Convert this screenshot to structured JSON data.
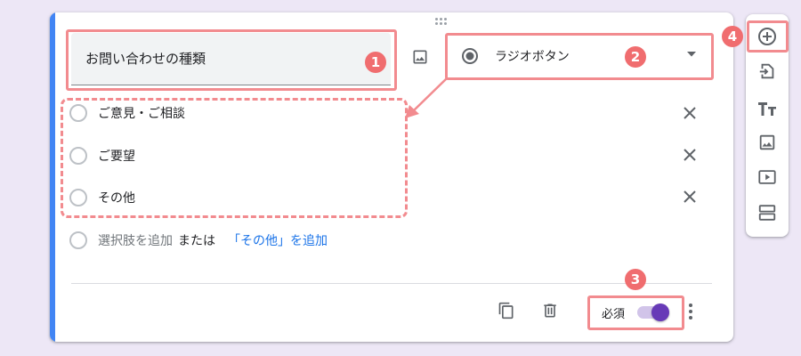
{
  "question": {
    "title": "お問い合わせの種類",
    "type_label": "ラジオボタン",
    "options": [
      {
        "label": "ご意見・ご相談"
      },
      {
        "label": "ご要望"
      },
      {
        "label": "その他"
      }
    ],
    "add_option_label": "選択肢を追加",
    "or_label": "または",
    "add_other_label": "「その他」を追加",
    "required_label": "必須"
  },
  "annotations": [
    "1",
    "2",
    "3",
    "4"
  ],
  "colors": {
    "background": "#ede7f6",
    "card_accent": "#4285f4",
    "highlight": "#f28b8f",
    "badge": "#f06d6f",
    "toggle_thumb": "#673ab7",
    "toggle_track": "#d1c4e9",
    "link": "#1a73e8"
  },
  "toggle": {
    "required_on": true
  },
  "icons": {
    "question_image": "image-icon",
    "type_radio": "radio-checked-icon",
    "dropdown": "dropdown-arrow-icon",
    "remove": "close-icon",
    "duplicate": "copy-icon",
    "delete": "trash-icon",
    "more": "more-vert-icon",
    "toolbar": [
      "add-circle-icon",
      "import-icon",
      "title-icon",
      "image-icon",
      "video-icon",
      "section-icon"
    ]
  }
}
